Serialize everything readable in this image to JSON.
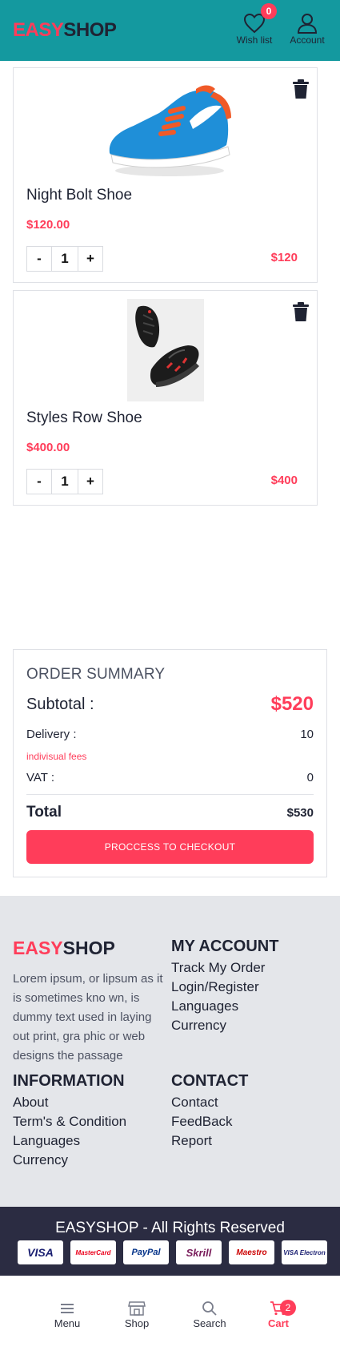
{
  "header": {
    "logo_easy": "EASY",
    "logo_shop": "SHOP",
    "wishlist_label": "Wish list",
    "wishlist_count": "0",
    "account_label": "Account"
  },
  "cart": {
    "items": [
      {
        "name": "Night Bolt Shoe",
        "price": "$120.00",
        "quantity": "1",
        "line_total": "$120",
        "qty_minus": "-",
        "qty_plus": "+"
      },
      {
        "name": "Styles Row Shoe",
        "price": "$400.00",
        "quantity": "1",
        "line_total": "$400",
        "qty_minus": "-",
        "qty_plus": "+"
      }
    ]
  },
  "summary": {
    "title": "ORDER SUMMARY",
    "subtotal_label": "Subtotal :",
    "subtotal_value": "$520",
    "delivery_label": "Delivery :",
    "delivery_value": "10",
    "fees_note": "indivisual fees",
    "vat_label": "VAT :",
    "vat_value": "0",
    "total_label": "Total",
    "total_value": "$530",
    "checkout_label": "PROCCESS TO CHECKOUT"
  },
  "footer": {
    "logo_easy": "EASY",
    "logo_shop": "SHOP",
    "description": "Lorem ipsum, or lipsum as it is sometimes kno wn, is dummy text used in laying out print, gra phic or web designs the passage",
    "my_account": {
      "heading": "MY ACCOUNT",
      "links": [
        "Track My Order",
        "Login/Register",
        "Languages",
        "Currency"
      ]
    },
    "information": {
      "heading": "INFORMATION",
      "links": [
        "About",
        "Term's & Condition",
        "Languages",
        "Currency"
      ]
    },
    "contact": {
      "heading": "CONTACT",
      "links": [
        "Contact",
        "FeedBack",
        "Report"
      ]
    },
    "copyright": "EASYSHOP - All Rights Reserved",
    "payment_cards": [
      "VISA",
      "MasterCard",
      "PayPal",
      "Skrill",
      "Maestro",
      "VISA Electron"
    ]
  },
  "bottom_nav": {
    "menu_label": "Menu",
    "shop_label": "Shop",
    "search_label": "Search",
    "cart_label": "Cart",
    "cart_count": "2"
  },
  "colors": {
    "header_bg": "#14999f",
    "accent": "#ff3d5a",
    "footer_bg": "#e4e6ea",
    "copyright_bg": "#2b2c42",
    "text_dark": "#1f2333"
  }
}
